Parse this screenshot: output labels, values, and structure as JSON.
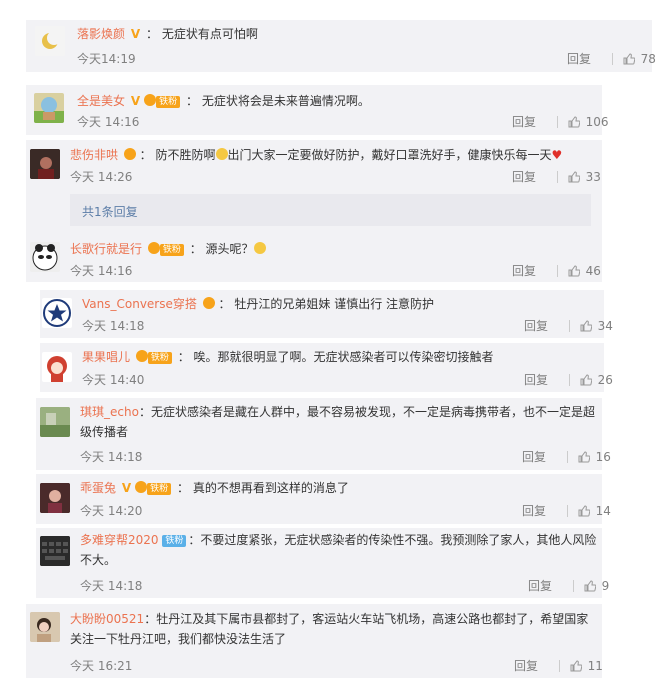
{
  "reply_label": "回复",
  "comments": [
    {
      "user": "落影焕颜",
      "sep": "：",
      "text": "无症状有点可怕啊",
      "time": "今天14:19",
      "likes": "78"
    },
    {
      "user": "全是美女",
      "fan": "铁粉",
      "sep": "：",
      "text": "无症状将会是未来普遍情况啊。",
      "time": "今天 14:16",
      "likes": "106"
    },
    {
      "user": "悲伤非哄",
      "sep": "：",
      "text": "防不胜防啊",
      "text2": "出门大家一定要做好防护，戴好口罩洗好手，健康快乐每一天",
      "time": "今天 14:26",
      "likes": "33",
      "more": "共1条回复"
    },
    {
      "user": "长歌行就是行",
      "fan": "铁粉",
      "sep": "：",
      "text": "源头呢？",
      "time": "今天 14:16",
      "likes": "46"
    },
    {
      "user": "Vans_Converse穿搭",
      "sep": "：",
      "text": "牡丹江的兄弟姐妹 谨慎出行 注意防护",
      "time": "今天 14:18",
      "likes": "34"
    },
    {
      "user": "果果唱儿",
      "fan": "铁粉",
      "sep": "：",
      "text": "唉。那就很明显了啊。无症状感染者可以传染密切接触者",
      "time": "今天 14:40",
      "likes": "26"
    },
    {
      "user": "琪琪_echo",
      "sep": "：",
      "text": "无症状感染者是藏在人群中，最不容易被发现，不一定是病毒携带者，也不一定是超",
      "text_cont": "级传播者",
      "time": "今天 14:18",
      "likes": "16"
    },
    {
      "user": "乖蛋兔",
      "fan": "铁粉",
      "sep": "：",
      "text": "真的不想再看到这样的消息了",
      "time": "今天 14:20",
      "likes": "14"
    },
    {
      "user": "多难穿帮2020",
      "fan": "铁粉",
      "sep": "：",
      "text": "不要过度紧张，无症状感染者的传染性不强。我预测除了家人，其他人风险",
      "text_cont": "不大。",
      "time": "今天 14:18",
      "likes": "9"
    },
    {
      "user": "大盼盼00521",
      "sep": "：",
      "text": "牡丹江及其下属市县都封了，客运站火车站飞机场，高速公路也都封了，希望国家",
      "text_cont": "关注一下牡丹江吧，我们都快没法生活了",
      "time": "今天 16:21",
      "likes": "11"
    }
  ]
}
